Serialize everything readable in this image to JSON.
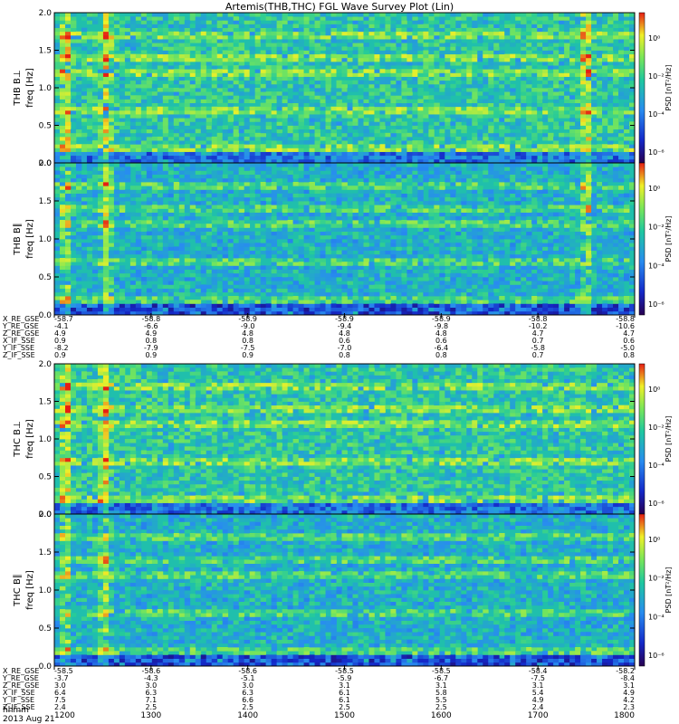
{
  "chart_data": {
    "type": "heatmap",
    "title": "Artemis(THB,THC) FGL Wave Survey Plot (Lin)",
    "colorbar_label": "PSD [nT²/Hz]",
    "colorbar_ticks": [
      "10⁰",
      "10⁻²",
      "10⁻⁴",
      "10⁻⁶"
    ],
    "freq_ylabel": "freq [Hz]",
    "freq_ticks": [
      "0.0",
      "0.5",
      "1.0",
      "1.5",
      "2.0"
    ],
    "ylim": [
      0,
      2.0
    ],
    "panels": [
      {
        "name": "THB B⊥"
      },
      {
        "name": "THB B∥"
      },
      {
        "name": "THC B⊥"
      },
      {
        "name": "THC B∥"
      }
    ],
    "time_axis": {
      "date": "2013 Aug 21",
      "hhmm_label": "hhmm",
      "ticks": [
        "1200",
        "1300",
        "1400",
        "1500",
        "1600",
        "1700",
        "1800"
      ]
    },
    "bursts": {
      "thb": [
        1200,
        1242,
        1738
      ],
      "thc": [
        1200,
        1240
      ]
    },
    "ephemeris": {
      "thb": {
        "rows": [
          {
            "label": "X_RE_GSE",
            "values": [
              "-58.7",
              "-58.8",
              "-58.9",
              "-58.9",
              "-58.9",
              "-58.8",
              "-58.8"
            ]
          },
          {
            "label": "Y_RE_GSE",
            "values": [
              "-4.1",
              "-6.6",
              "-9.0",
              "-9.4",
              "-9.8",
              "-10.2",
              "-10.6"
            ]
          },
          {
            "label": "Z_RE_GSE",
            "values": [
              "4.9",
              "4.9",
              "4.8",
              "4.8",
              "4.8",
              "4.7",
              "4.7"
            ]
          },
          {
            "label": "X_IF_SSE",
            "values": [
              "0.9",
              "0.8",
              "0.8",
              "0.6",
              "0.6",
              "0.7",
              "0.6"
            ]
          },
          {
            "label": "Y_IF_SSE",
            "values": [
              "-8.2",
              "-7.9",
              "-7.5",
              "-7.0",
              "-6.4",
              "-5.8",
              "-5.0"
            ]
          },
          {
            "label": "Z_IF_SSE",
            "values": [
              "0.9",
              "0.9",
              "0.9",
              "0.8",
              "0.8",
              "0.7",
              "0.8"
            ]
          }
        ]
      },
      "thc": {
        "rows": [
          {
            "label": "X_RE_GSE",
            "values": [
              "-58.5",
              "-58.6",
              "-58.6",
              "-58.5",
              "-58.5",
              "-58.4",
              "-58.2"
            ]
          },
          {
            "label": "Y_RE_GSE",
            "values": [
              "-3.7",
              "-4.3",
              "-5.1",
              "-5.9",
              "-6.7",
              "-7.5",
              "-8.4"
            ]
          },
          {
            "label": "Z_RE_GSE",
            "values": [
              "3.0",
              "3.0",
              "3.0",
              "3.1",
              "3.1",
              "3.1",
              "3.1"
            ]
          },
          {
            "label": "X_IF_SSE",
            "values": [
              "6.4",
              "6.3",
              "6.3",
              "6.1",
              "5.8",
              "5.4",
              "4.9"
            ]
          },
          {
            "label": "Y_IF_SSE",
            "values": [
              "7.5",
              "7.1",
              "6.6",
              "6.1",
              "5.5",
              "4.9",
              "4.2"
            ]
          },
          {
            "label": "Z_IF_SSE",
            "values": [
              "2.4",
              "2.5",
              "2.5",
              "2.5",
              "2.5",
              "2.4",
              "2.3"
            ]
          }
        ]
      }
    }
  }
}
